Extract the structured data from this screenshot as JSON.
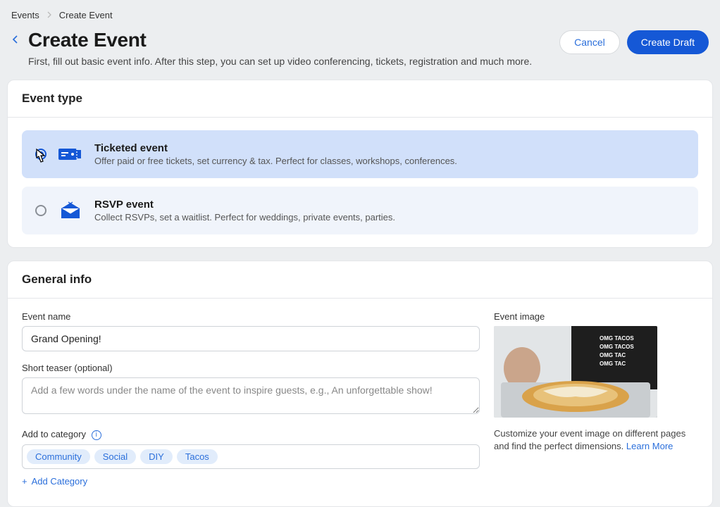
{
  "breadcrumb": {
    "root": "Events",
    "current": "Create Event"
  },
  "header": {
    "title": "Create Event",
    "subtitle": "First, fill out basic event info. After this step, you can set up video conferencing, tickets, registration and much more.",
    "cancel": "Cancel",
    "create_draft": "Create Draft"
  },
  "event_type": {
    "heading": "Event type",
    "ticketed": {
      "title": "Ticketed event",
      "desc": "Offer paid or free tickets, set currency & tax. Perfect for classes, workshops, conferences."
    },
    "rsvp": {
      "title": "RSVP event",
      "desc": "Collect RSVPs, set a waitlist. Perfect for weddings, private events, parties."
    }
  },
  "general": {
    "heading": "General info",
    "name_label": "Event name",
    "name_value": "Grand Opening!",
    "teaser_label": "Short teaser (optional)",
    "teaser_placeholder": "Add a few words under the name of the event to inspire guests, e.g., An unforgettable show!",
    "category_label": "Add to category",
    "categories": [
      "Community",
      "Social",
      "DIY",
      "Tacos"
    ],
    "add_category": "Add Category",
    "image_label": "Event image",
    "image_hint": "Customize your event image on different pages and find the perfect dimensions.",
    "learn_more": "Learn More"
  }
}
